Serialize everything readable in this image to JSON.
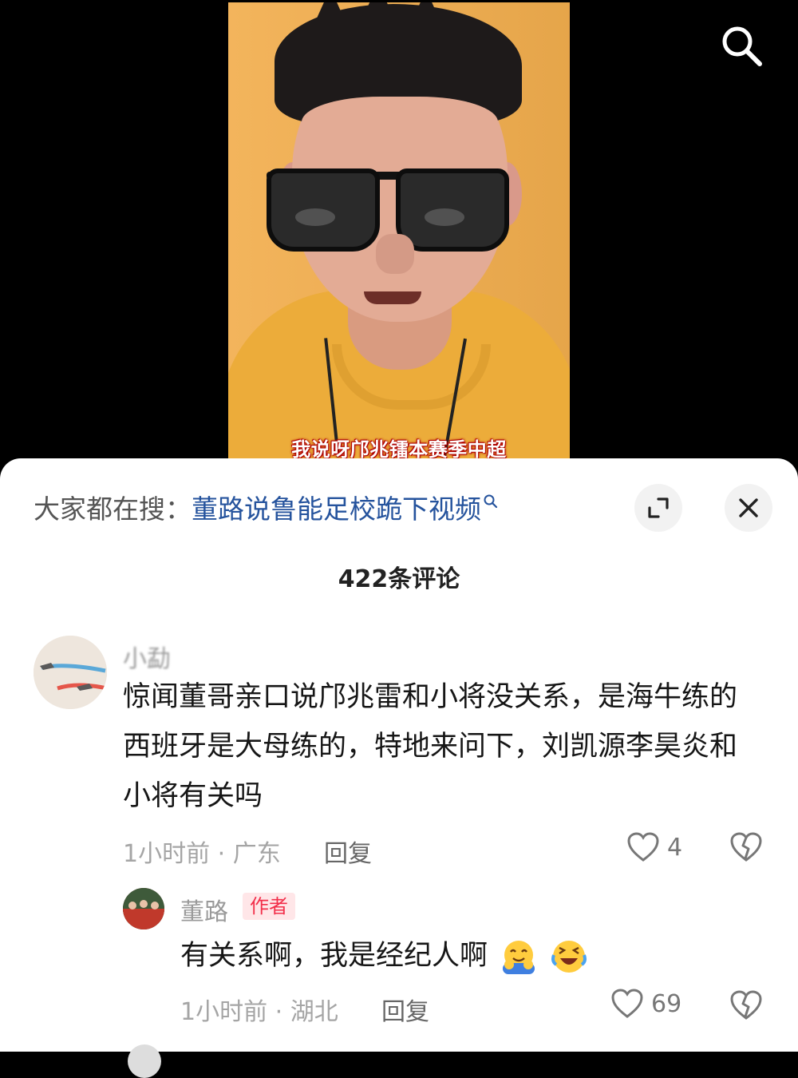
{
  "video": {
    "subtitle": "我说呀邝兆镭本赛季中超"
  },
  "header_search_icon": "search-icon",
  "sheet": {
    "search_prefix": "大家都在搜：",
    "search_query": "董路说鲁能足校跪下视频",
    "comment_count": "422条评论"
  },
  "comments": [
    {
      "username": "小勐",
      "text": "惊闻董哥亲口说邝兆雷和小将没关系，是海牛练的西班牙是大母练的，特地来问下，刘凯源李昊炎和小将有关吗",
      "meta": "1小时前 · 广东",
      "reply_label": "回复",
      "likes": "4"
    },
    {
      "username": "董路",
      "badge": "作者",
      "text": "有关系啊，我是经纪人啊",
      "meta": "1小时前 · 湖北",
      "reply_label": "回复",
      "likes": "69"
    }
  ],
  "colors": {
    "query_link": "#25539d",
    "author_badge_bg": "#ffe6e8",
    "author_badge_text": "#f22f4a",
    "video_bg": "#f2ae4e"
  }
}
